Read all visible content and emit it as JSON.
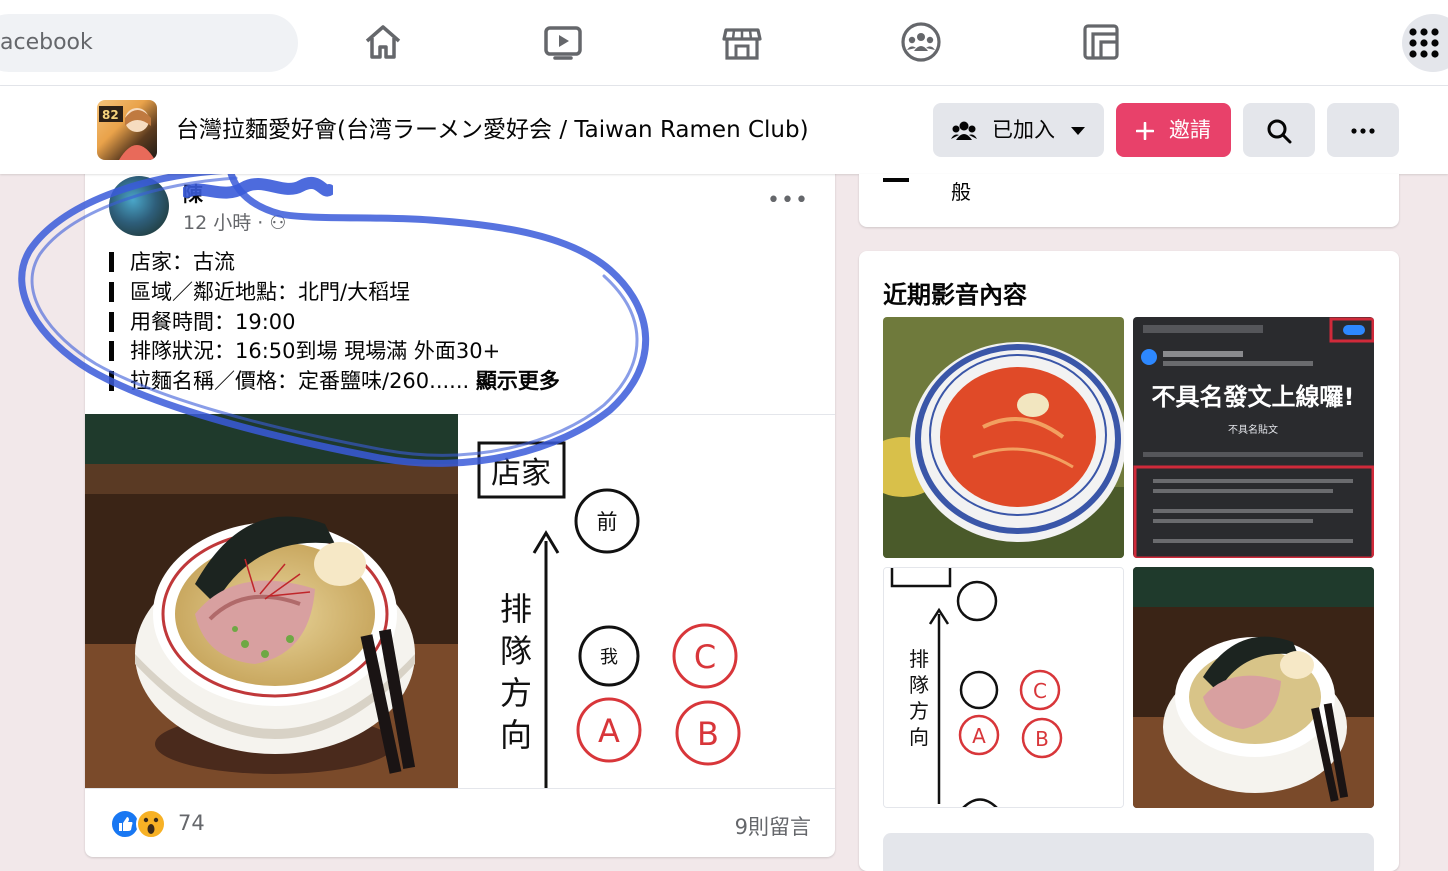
{
  "top_nav": {
    "search_partial": "acebook",
    "icons": [
      "home-icon",
      "watch-icon",
      "marketplace-icon",
      "groups-icon",
      "gaming-icon",
      "menu-grid-icon"
    ]
  },
  "group": {
    "title": "台灣拉麵愛好會(台湾ラーメン愛好会 / Taiwan Ramen Club)",
    "joined_label": "已加入",
    "invite_label": "邀請",
    "logo_text": "82"
  },
  "post": {
    "author_partial": "陳",
    "time": "12 小時",
    "lines": [
      "店家：古流",
      "區域／鄰近地點：北門/大稻埕",
      "用餐時間：19:00",
      "排隊狀況：16:50到場 現場滿 外面30+",
      "拉麵名稱／價格：定番鹽味/260......"
    ],
    "see_more": "顯示更多",
    "diagram": {
      "store": "店家",
      "front": "前",
      "direction": [
        "排",
        "隊",
        "方",
        "向"
      ],
      "me": "我",
      "labels": [
        "C",
        "A",
        "B"
      ]
    },
    "reactions_count": "74",
    "comments": "9則留言"
  },
  "sidebar": {
    "top_card_text": "般",
    "media_title": "近期影音內容",
    "thumb_banner": "不具名發文上線囉!",
    "thumb_banner_sub": "不具名貼文"
  },
  "colors": {
    "accent_pink": "#e8416a",
    "page_bg": "#f2e8ea",
    "annotation_blue": "#3a5bd9"
  }
}
